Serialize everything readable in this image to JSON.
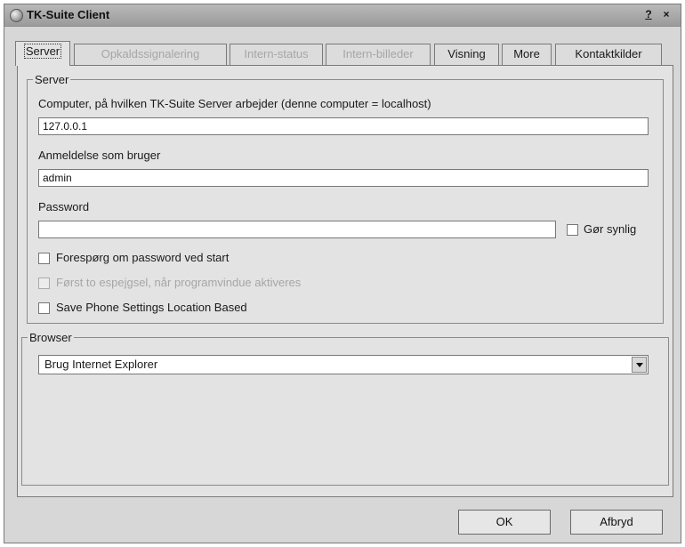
{
  "window": {
    "title": "TK-Suite Client",
    "help_label": "?",
    "close_label": "×"
  },
  "tabs": [
    {
      "label": "Server",
      "state": "active"
    },
    {
      "label": "Opkaldssignalering",
      "state": "disabled"
    },
    {
      "label": "Intern-status",
      "state": "disabled"
    },
    {
      "label": "Intern-billeder",
      "state": "disabled"
    },
    {
      "label": "Visning",
      "state": "enabled"
    },
    {
      "label": "More",
      "state": "enabled"
    },
    {
      "label": "Kontaktkilder",
      "state": "enabled"
    }
  ],
  "server": {
    "legend": "Server",
    "computer_label": "Computer, på hvilken TK-Suite Server arbejder (denne computer = localhost)",
    "computer_value": "127.0.0.1",
    "login_label": "Anmeldelse som bruger",
    "login_value": "admin",
    "password_label": "Password",
    "password_value": "",
    "show_label": "Gør synlig",
    "ask_password_label": "Forespørg om password ved start",
    "bring_front_label": "Først to espejgsel, når programvindue aktiveres",
    "save_phone_label": "Save Phone Settings Location Based"
  },
  "browser": {
    "legend": "Browser",
    "selected": "Brug Internet Explorer"
  },
  "buttons": {
    "ok": "OK",
    "cancel": "Afbryd"
  }
}
